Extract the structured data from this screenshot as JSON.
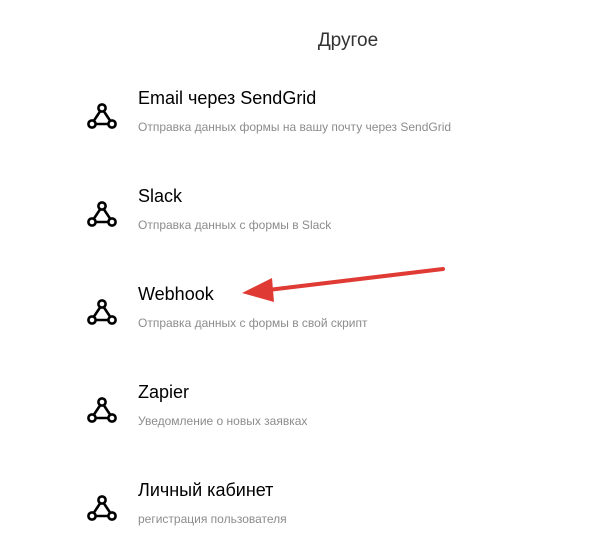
{
  "section": {
    "title": "Другое"
  },
  "items": [
    {
      "title": "Email через SendGrid",
      "description": "Отправка данных формы на вашу почту через SendGrid",
      "icon": "webhook-icon"
    },
    {
      "title": "Slack",
      "description": "Отправка данных с формы в Slack",
      "icon": "webhook-icon"
    },
    {
      "title": "Webhook",
      "description": "Отправка данных с формы в свой скрипт",
      "icon": "webhook-icon"
    },
    {
      "title": "Zapier",
      "description": "Уведомление о новых заявках",
      "icon": "webhook-icon"
    },
    {
      "title": "Личный кабинет",
      "description": "регистрация пользователя",
      "icon": "webhook-icon"
    }
  ],
  "annotation": {
    "arrow_color": "#e03a35",
    "icon": "red-arrow-icon"
  }
}
